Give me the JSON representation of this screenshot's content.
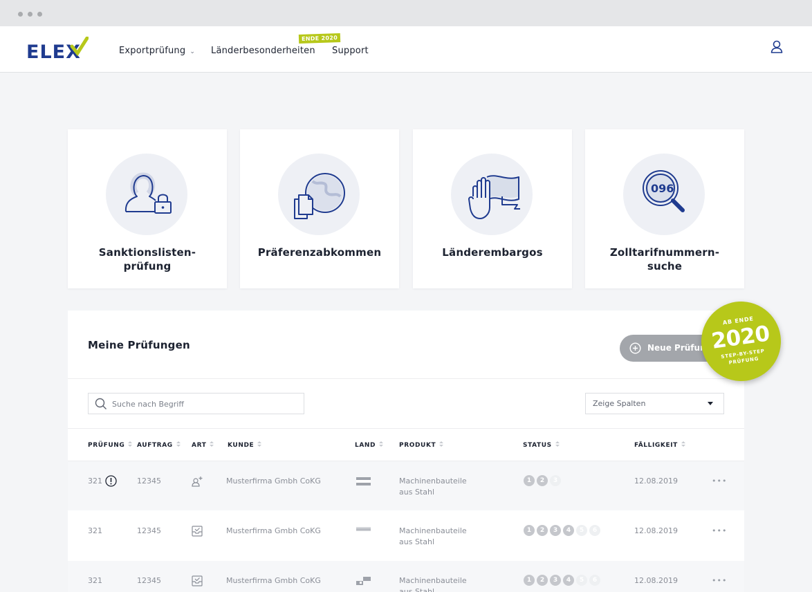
{
  "app": {
    "logo_text": "ELEX",
    "colors": {
      "brand_blue": "#1f3b8f",
      "brand_green": "#b7c81a",
      "text": "#1c2230",
      "muted": "#8a8e97"
    }
  },
  "nav": {
    "items": [
      {
        "label": "Exportprüfung",
        "caret": "⌄"
      },
      {
        "label": "Länderbesonderheiten",
        "badge": "ENDE 2020"
      },
      {
        "label": "Support"
      }
    ],
    "user_icon": "user-icon"
  },
  "cards": [
    {
      "title": "Sanktionslisten-\nprüfung",
      "icon": "user-lock-icon"
    },
    {
      "title": "Präferenzabkommen",
      "icon": "globe-documents-icon"
    },
    {
      "title": "Länderembargos",
      "icon": "hand-flag-icon"
    },
    {
      "title": "Zolltarifnummern-\nsuche",
      "icon": "magnifier-code-icon"
    }
  ],
  "panel": {
    "title": "Meine Prüfungen",
    "new_button": "Neue Prüfung",
    "search_placeholder": "Suche nach Begriff",
    "columns_select": "Zeige Spalten",
    "headers": [
      "PRÜFUNG",
      "AUFTRAG",
      "ART",
      "KUNDE",
      "LAND",
      "PRODUKT",
      "STATUS",
      "FÄLLIGKEIT"
    ],
    "rows": [
      {
        "pruefung": "321",
        "warning": true,
        "auftrag": "12345",
        "art": "user-plus-icon",
        "kunde": "Musterfirma Gmbh CoKG",
        "land": "flag-icon",
        "produkt": "Machinenbauteile\naus Stahl",
        "steps_total": 3,
        "steps_done": 2,
        "faelligkeit": "12.08.2019",
        "more": "•••"
      },
      {
        "pruefung": "321",
        "warning": false,
        "auftrag": "12345",
        "art": "inbox-check-icon",
        "kunde": "Musterfirma Gmbh CoKG",
        "land": "flag-icon",
        "produkt": "Machinenbauteile\naus Stahl",
        "steps_total": 6,
        "steps_done": 4,
        "faelligkeit": "12.08.2019",
        "more": "•••"
      },
      {
        "pruefung": "321",
        "warning": false,
        "auftrag": "12345",
        "art": "inbox-check-icon",
        "kunde": "Musterfirma Gmbh CoKG",
        "land": "flag-icon",
        "produkt": "Machinenbauteile\naus Stahl",
        "steps_total": 6,
        "steps_done": 4,
        "faelligkeit": "12.08.2019",
        "more": "•••"
      }
    ]
  },
  "sticker": {
    "line1": "AB ENDE",
    "year": "2020",
    "line3": "STEP-BY-STEP",
    "line4": "PRÜFUNG"
  }
}
